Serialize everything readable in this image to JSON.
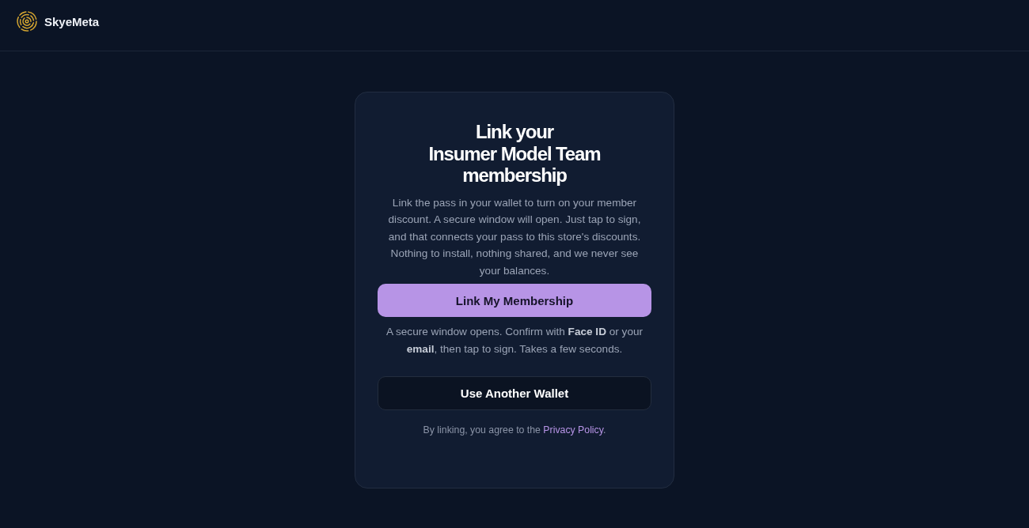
{
  "header": {
    "brand": "SkyeMeta"
  },
  "card": {
    "title": "Link your\nInsumer Model Team membership",
    "description": "Link the pass in your wallet to turn on your member discount. A secure window will open. Just tap to sign, and that connects your pass to this store's discounts. Nothing to install, nothing shared, and we never see your balances.",
    "primary_button": "Link My Membership",
    "hint": "A secure window opens. Confirm with **Face ID** or your **email**, then tap to sign. Takes a few seconds.",
    "secondary_button": "Use Another Wallet",
    "consent": {
      "text_before": "By linking, you agree to the ",
      "link": "Privacy Policy",
      "text_after": "."
    }
  }
}
